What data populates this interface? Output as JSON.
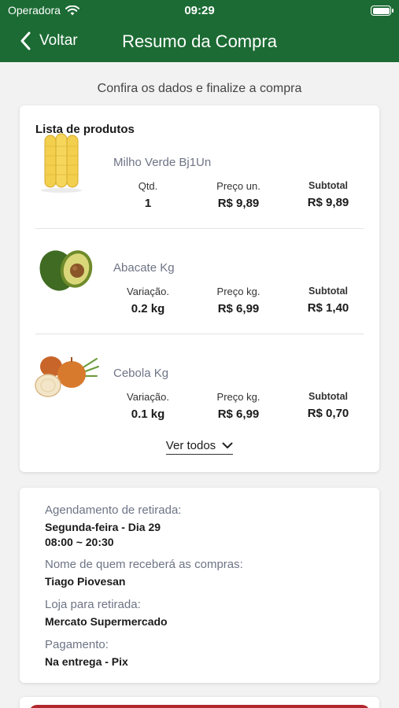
{
  "status_bar": {
    "carrier": "Operadora",
    "time": "09:29"
  },
  "nav": {
    "back_label": "Voltar",
    "title": "Resumo da Compra"
  },
  "subtitle": "Confira os dados e finalize a compra",
  "products": {
    "title": "Lista de produtos",
    "items": [
      {
        "name": "Milho Verde Bj1Un",
        "image": "corn",
        "qty_label": "Qtd.",
        "qty": "1",
        "price_label": "Preço un.",
        "price": "R$ 9,89",
        "subtotal_label": "Subtotal",
        "subtotal": "R$ 9,89"
      },
      {
        "name": "Abacate Kg",
        "image": "avocado",
        "qty_label": "Variação.",
        "qty": "0.2 kg",
        "price_label": "Preço kg.",
        "price": "R$ 6,99",
        "subtotal_label": "Subtotal",
        "subtotal": "R$ 1,40"
      },
      {
        "name": "Cebola Kg",
        "image": "onion",
        "qty_label": "Variação.",
        "qty": "0.1 kg",
        "price_label": "Preço kg.",
        "price": "R$ 6,99",
        "subtotal_label": "Subtotal",
        "subtotal": "R$ 0,70"
      }
    ],
    "see_all": "Ver todos"
  },
  "details": {
    "pickup_label": "Agendamento de retirada:",
    "pickup_day": "Segunda-feira - Dia 29",
    "pickup_time": "08:00 ~ 20:30",
    "receiver_label": "Nome de quem receberá as compras:",
    "receiver": "Tiago Piovesan",
    "store_label": "Loja para retirada:",
    "store": "Mercato Supermercado",
    "payment_label": "Pagamento:",
    "payment": "Na entrega - Pix"
  },
  "colors": {
    "header": "#1c6b34",
    "background": "#f2f2f2",
    "accent_red": "#b0282e",
    "muted_text": "#6d7485"
  },
  "icons": [
    "wifi-icon",
    "battery-icon",
    "chevron-left-icon",
    "chevron-down-icon"
  ]
}
